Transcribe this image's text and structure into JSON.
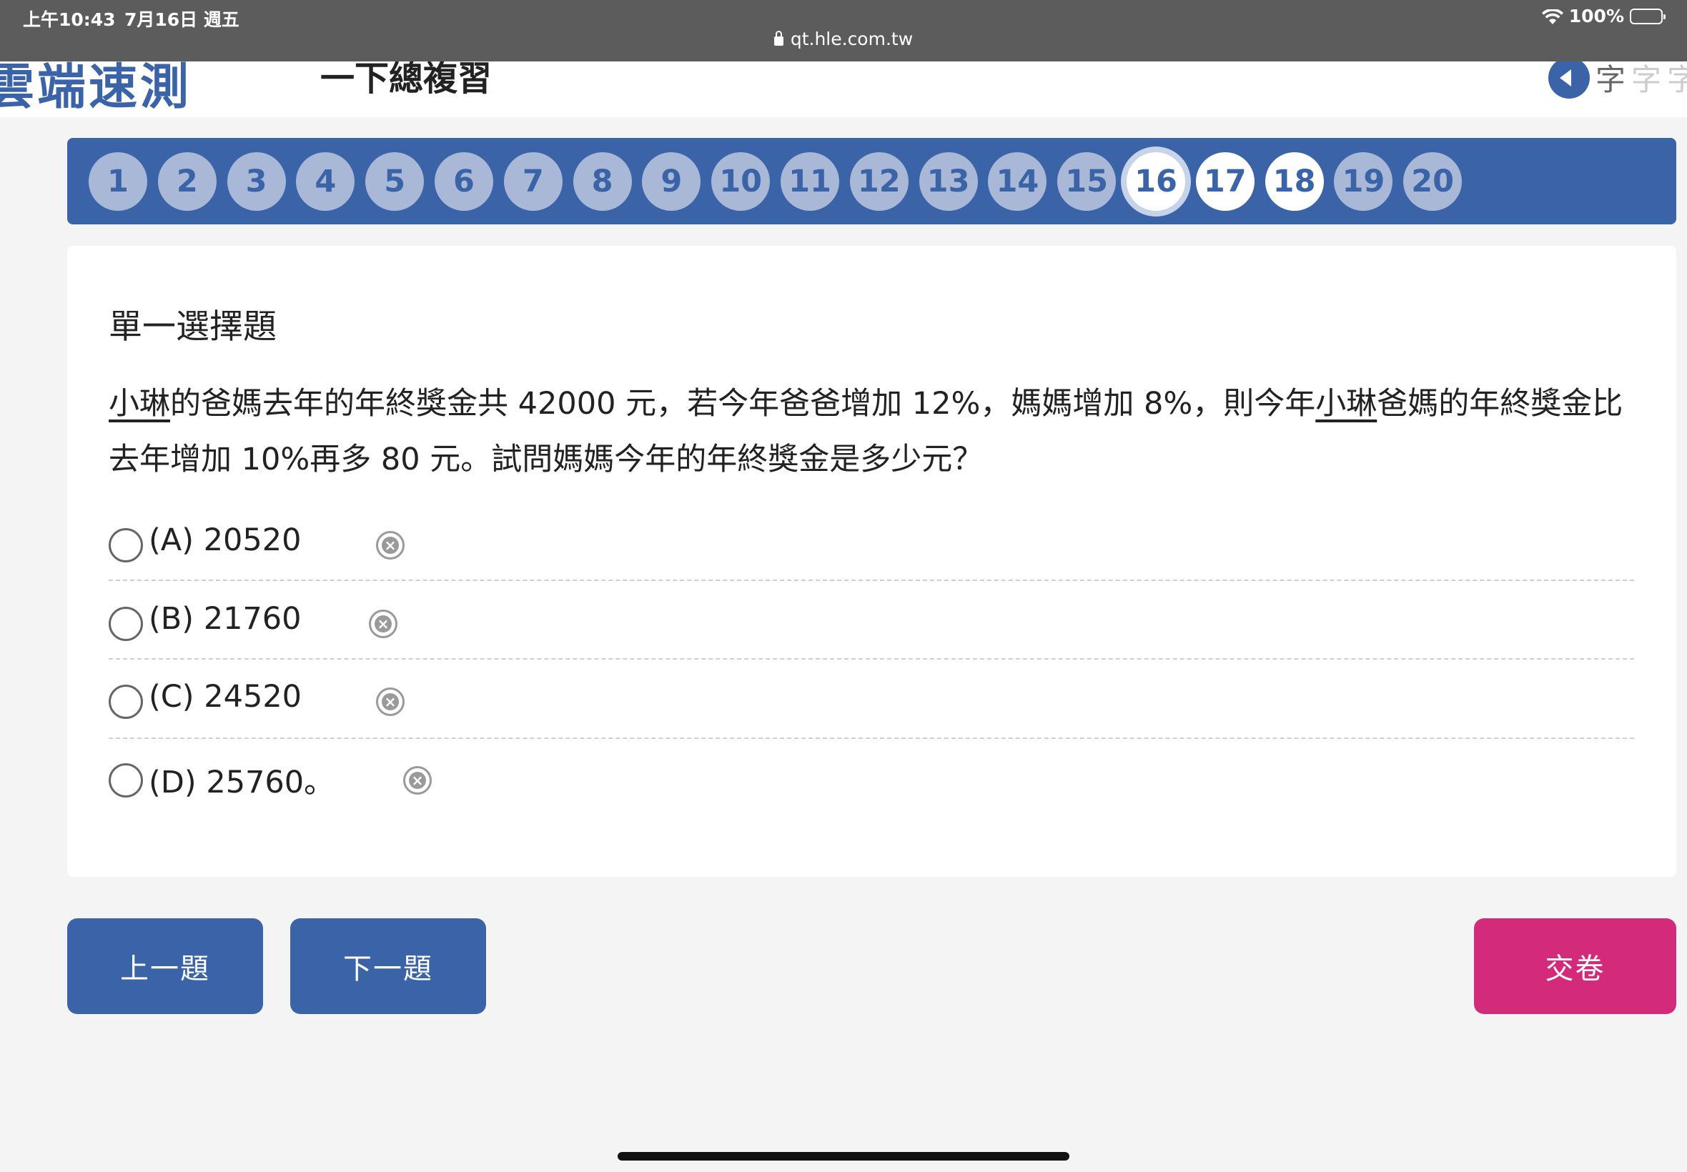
{
  "status_bar": {
    "time": "上午10:43",
    "date": "7月16日 週五",
    "url": "qt.hle.com.tw",
    "battery": "100%"
  },
  "header": {
    "logo": "雲端速測",
    "exam_title": "一下總複習",
    "font_size_glyph": "字"
  },
  "question_nav": {
    "numbers": [
      "1",
      "2",
      "3",
      "4",
      "5",
      "6",
      "7",
      "8",
      "9",
      "10",
      "11",
      "12",
      "13",
      "14",
      "15",
      "16",
      "17",
      "18",
      "19",
      "20"
    ],
    "current": "16"
  },
  "question": {
    "type": "單一選擇題",
    "name": "小琳",
    "text_part1": "的爸媽去年的年終獎金共 42000 元，若今年爸爸增加 12%，媽媽增加 8%，則今年",
    "text_part2": "爸媽的年終獎金比去年增加 10%再多 80 元。試問媽媽今年的年終獎金是多少元？",
    "options": [
      {
        "label": "(A) 20520"
      },
      {
        "label": "(B) 21760"
      },
      {
        "label": "(C) 24520"
      },
      {
        "label": "(D) 25760。"
      }
    ]
  },
  "buttons": {
    "prev": "上一題",
    "next": "下一題",
    "submit": "交卷"
  },
  "colors": {
    "primary": "#3b63a7",
    "submit": "#d42a7c",
    "status_bar": "#5c5c5c"
  }
}
